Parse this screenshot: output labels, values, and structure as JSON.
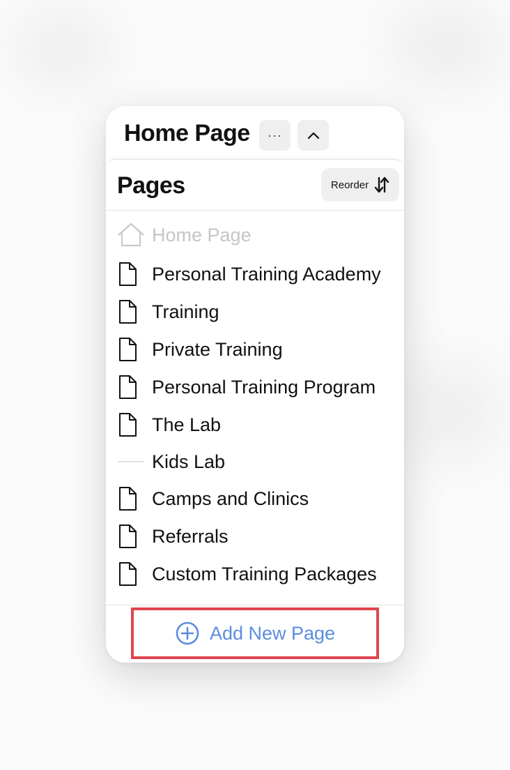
{
  "colors": {
    "accent": "#5b8ce0",
    "highlight_border": "#e0454f",
    "muted_text": "#c6c6c6",
    "button_bg": "#efefef"
  },
  "header": {
    "title": "Home Page",
    "more_icon": "ellipsis-icon",
    "more_label": "···",
    "collapse_icon": "chevron-up-icon"
  },
  "pages_panel": {
    "title": "Pages",
    "reorder_label": "Reorder",
    "reorder_icon": "sort-arrows-icon",
    "items": [
      {
        "label": "Home Page",
        "icon": "home-icon",
        "muted": true
      },
      {
        "label": "Personal Training Academy",
        "icon": "page-icon"
      },
      {
        "label": "Training",
        "icon": "page-icon"
      },
      {
        "label": "Private Training",
        "icon": "page-icon"
      },
      {
        "label": "Personal Training Program",
        "icon": "page-icon"
      },
      {
        "label": "The Lab",
        "icon": "page-icon"
      },
      {
        "label": "Kids Lab",
        "icon": "link-line-icon"
      },
      {
        "label": "Camps and Clinics",
        "icon": "page-icon"
      },
      {
        "label": "Referrals",
        "icon": "page-icon"
      },
      {
        "label": "Custom Training Packages",
        "icon": "page-icon"
      }
    ],
    "add_label": "Add New Page",
    "add_icon": "plus-circle-icon"
  }
}
